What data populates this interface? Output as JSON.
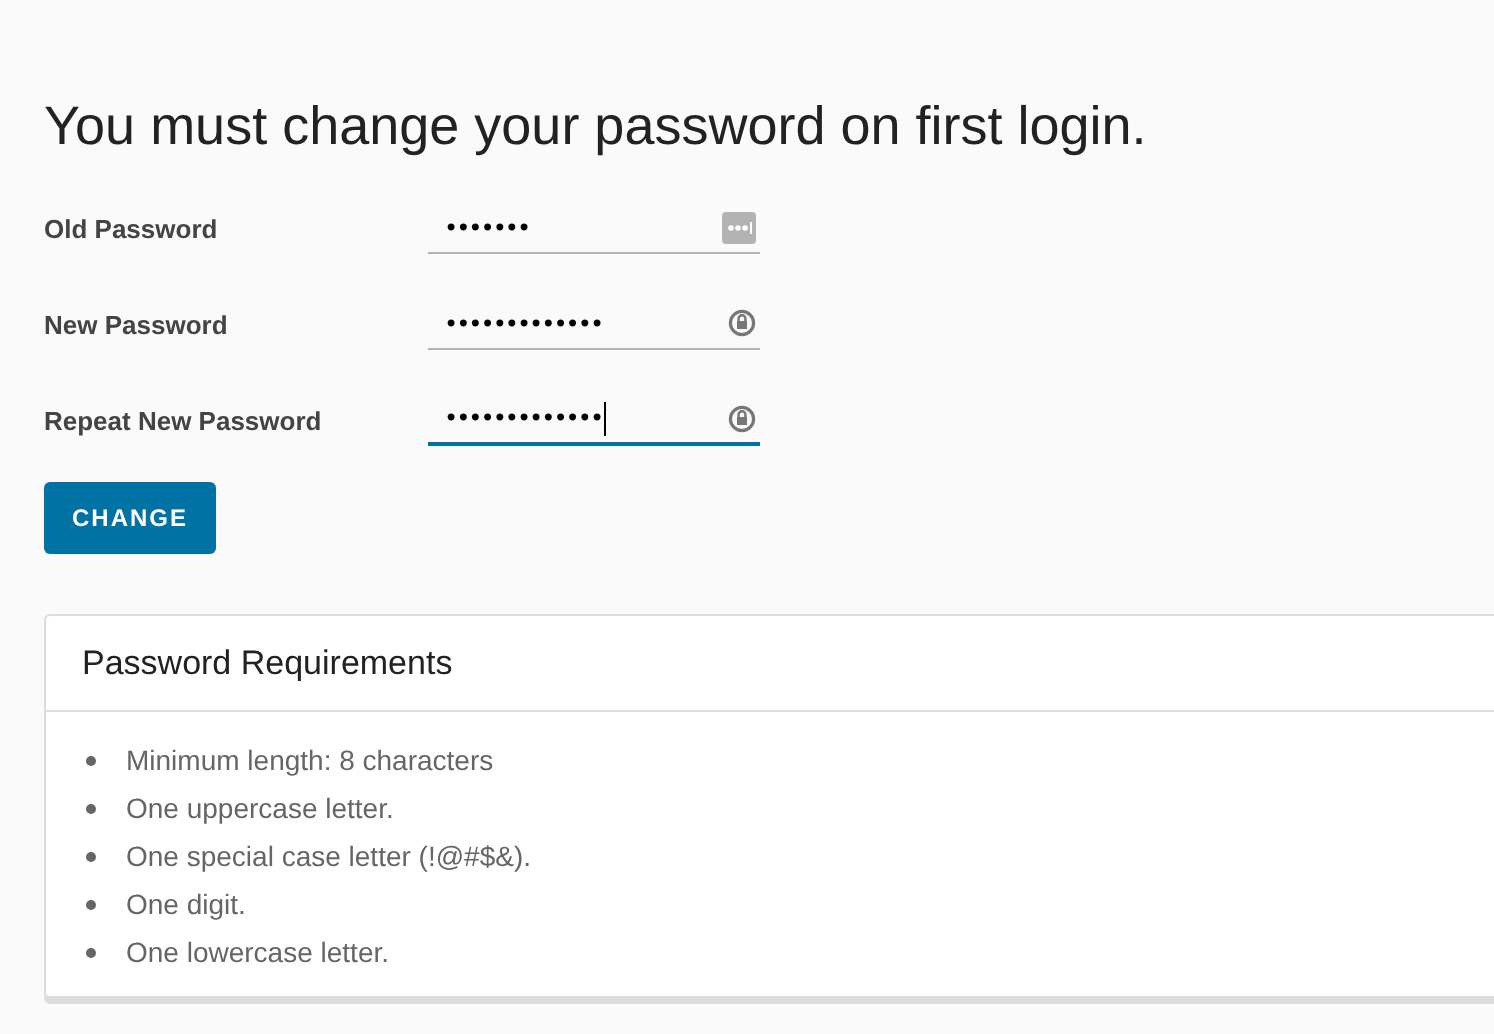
{
  "title": "You must change your password on first login.",
  "fields": [
    {
      "label": "Old Password",
      "value": "•••••••",
      "kind": "saved",
      "focused": false
    },
    {
      "label": "New Password",
      "value": "•••••••••••••",
      "kind": "generated",
      "focused": false
    },
    {
      "label": "Repeat New Password",
      "value": "•••••••••••••",
      "kind": "generated",
      "focused": true
    }
  ],
  "button": "CHANGE",
  "requirements": {
    "title": "Password Requirements",
    "items": [
      "Minimum length: 8 characters",
      "One uppercase letter.",
      "One special case letter (!@#$&).",
      "One digit.",
      "One lowercase letter."
    ]
  }
}
